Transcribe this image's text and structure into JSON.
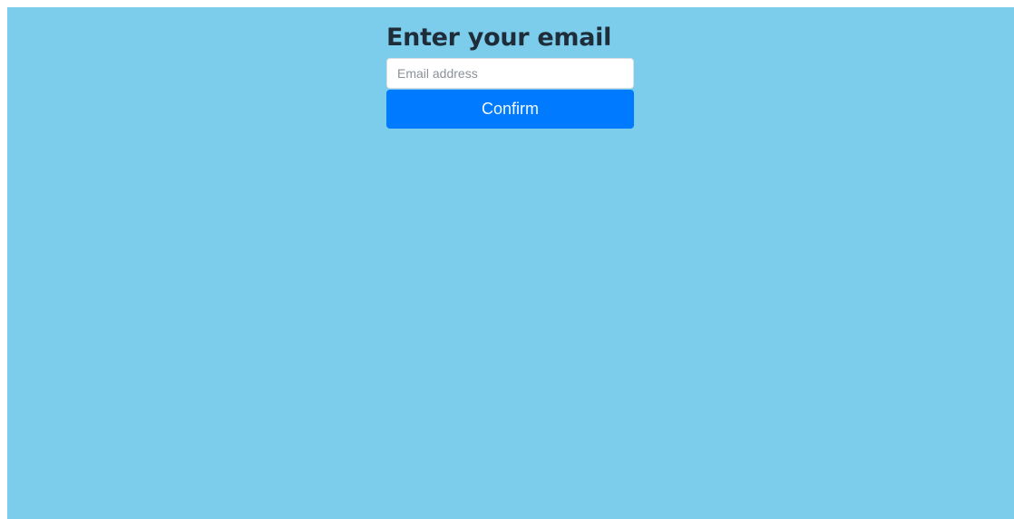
{
  "form": {
    "title": "Enter your email",
    "email_placeholder": "Email address",
    "email_value": "",
    "confirm_label": "Confirm"
  },
  "colors": {
    "background": "#7ccdeb",
    "button": "#007bff",
    "title_text": "#1f2d3a"
  }
}
